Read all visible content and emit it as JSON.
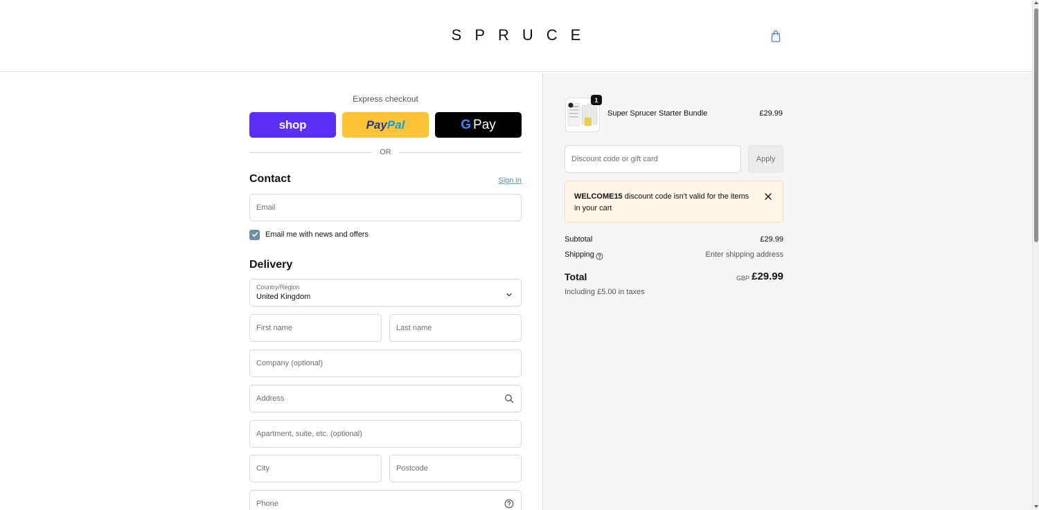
{
  "header": {
    "logo": "SPRUCE",
    "cart_icon": "shopping-bag-icon"
  },
  "express": {
    "label": "Express checkout",
    "shop_label": "shop",
    "paypal_part1": "Pay",
    "paypal_part2": "Pal",
    "gpay_g": "G",
    "gpay_label": "Pay",
    "or_text": "OR",
    "colors": {
      "shop": "#5a31f4",
      "paypal": "#ffc439",
      "gpay": "#000000"
    }
  },
  "contact": {
    "title": "Contact",
    "sign_in": "Sign in",
    "email_placeholder": "Email",
    "newsletter_label": "Email me with news and offers",
    "newsletter_checked": true
  },
  "delivery": {
    "title": "Delivery",
    "country_label": "Country/Region",
    "country_value": "United Kingdom",
    "first_name_placeholder": "First name",
    "last_name_placeholder": "Last name",
    "company_placeholder": "Company (optional)",
    "address_placeholder": "Address",
    "apartment_placeholder": "Apartment, suite, etc. (optional)",
    "city_placeholder": "City",
    "postcode_placeholder": "Postcode",
    "phone_placeholder": "Phone"
  },
  "summary": {
    "product": {
      "name": "Super Sprucer Starter Bundle",
      "price": "£29.99",
      "quantity": "1"
    },
    "discount_placeholder": "Discount code or gift card",
    "apply_label": "Apply",
    "alert": {
      "code": "WELCOME15",
      "message": " discount code isn't valid for the items in your cart"
    },
    "subtotal_label": "Subtotal",
    "subtotal_value": "£29.99",
    "shipping_label": "Shipping",
    "shipping_value": "Enter shipping address",
    "total_label": "Total",
    "total_currency": "GBP",
    "total_value": "£29.99",
    "taxes_note": "Including £5.00 in taxes"
  }
}
